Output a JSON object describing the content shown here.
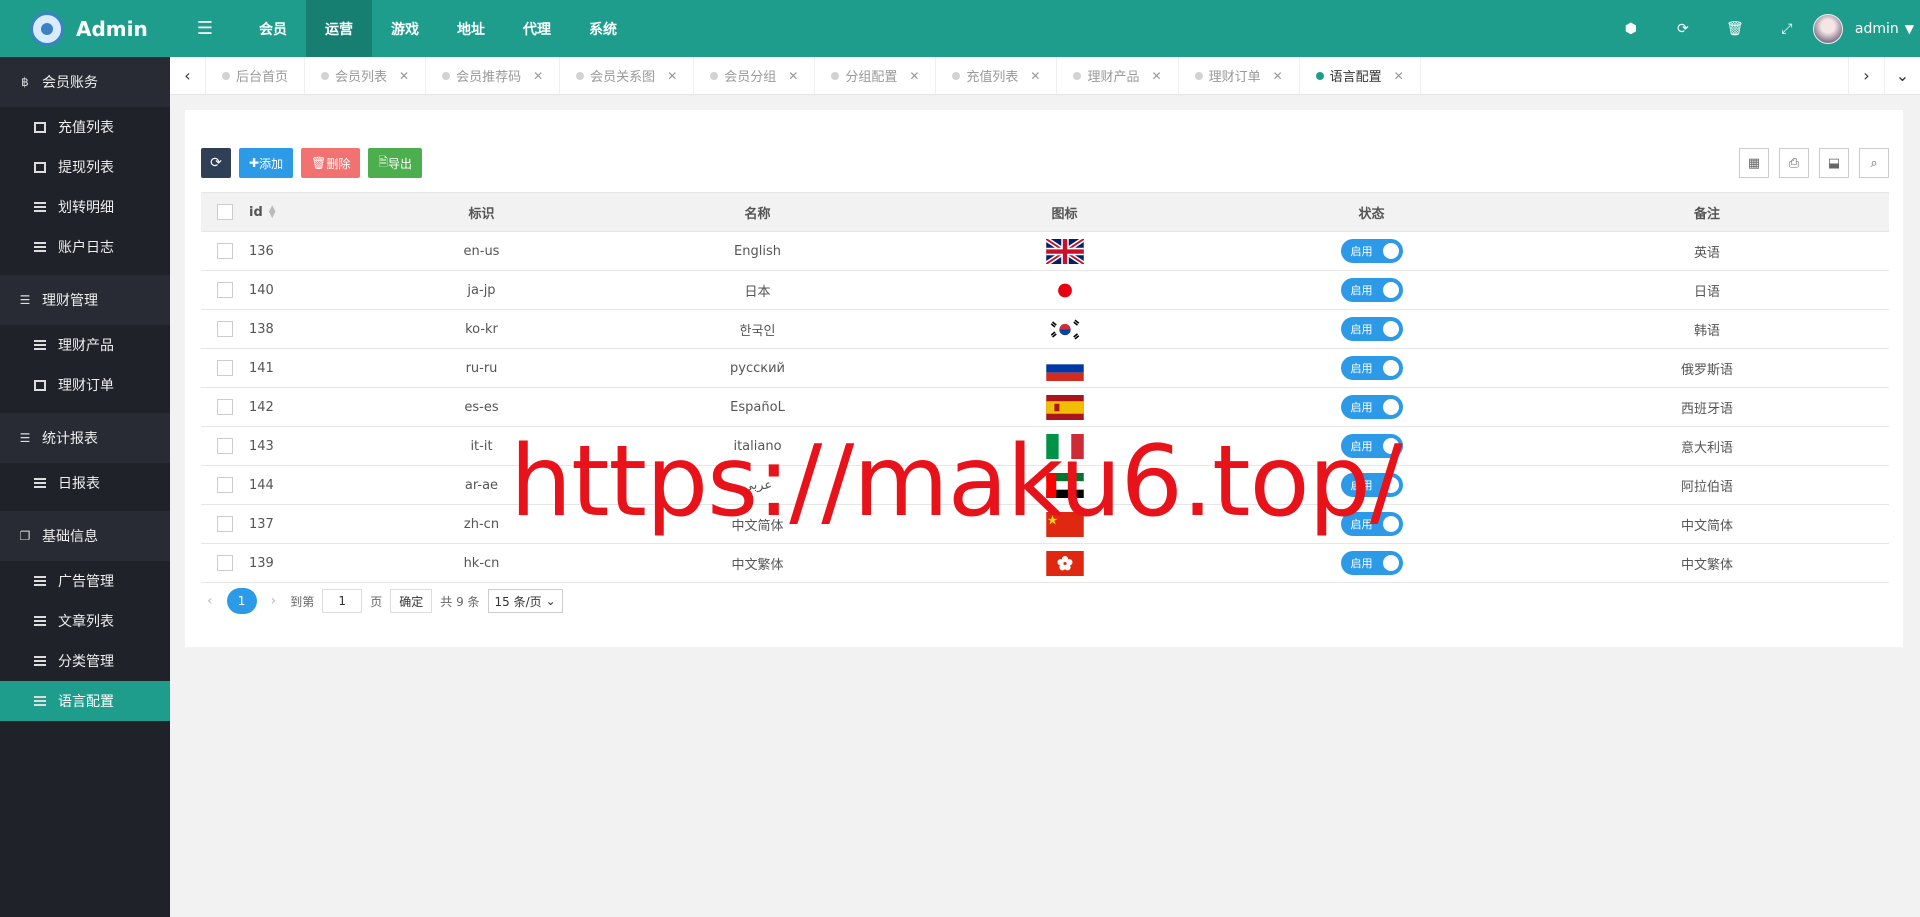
{
  "app": {
    "title": "Admin"
  },
  "sidebar": {
    "groups": [
      {
        "label": "会员账务",
        "items": [
          "充值列表",
          "提现列表",
          "划转明细",
          "账户日志"
        ]
      },
      {
        "label": "理财管理",
        "items": [
          "理财产品",
          "理财订单"
        ]
      },
      {
        "label": "统计报表",
        "items": [
          "日报表"
        ]
      },
      {
        "label": "基础信息",
        "items": [
          "广告管理",
          "文章列表",
          "分类管理",
          "语言配置"
        ]
      }
    ],
    "active_item": "语言配置"
  },
  "header": {
    "nav": [
      "会员",
      "运营",
      "游戏",
      "地址",
      "代理",
      "系统"
    ],
    "active_nav": "运营",
    "user": "admin"
  },
  "tabs": [
    "后台首页",
    "会员列表",
    "会员推荐码",
    "会员关系图",
    "会员分组",
    "分组配置",
    "充值列表",
    "理财产品",
    "理财订单",
    "语言配置"
  ],
  "active_tab": "语言配置",
  "toolbar": {
    "add_label": "添加",
    "delete_label": "删除",
    "export_label": "导出"
  },
  "table": {
    "columns": [
      "id",
      "标识",
      "名称",
      "图标",
      "状态",
      "备注"
    ],
    "status_label": "启用",
    "rows": [
      {
        "id": "136",
        "code": "en-us",
        "name": "English",
        "flag": "uk-flag",
        "remark": "英语"
      },
      {
        "id": "140",
        "code": "ja-jp",
        "name": "日本",
        "flag": "japan-flag",
        "remark": "日语"
      },
      {
        "id": "138",
        "code": "ko-kr",
        "name": "한국인",
        "flag": "korea-flag",
        "remark": "韩语"
      },
      {
        "id": "141",
        "code": "ru-ru",
        "name": "русский",
        "flag": "russia-flag",
        "remark": "俄罗斯语"
      },
      {
        "id": "142",
        "code": "es-es",
        "name": "EspañoL",
        "flag": "spain-flag",
        "remark": "西班牙语"
      },
      {
        "id": "143",
        "code": "it-it",
        "name": "italiano",
        "flag": "italy-flag",
        "remark": "意大利语"
      },
      {
        "id": "144",
        "code": "ar-ae",
        "name": "عربي",
        "flag": "uae-flag",
        "remark": "阿拉伯语"
      },
      {
        "id": "137",
        "code": "zh-cn",
        "name": "中文简体",
        "flag": "china-flag",
        "remark": "中文简体"
      },
      {
        "id": "139",
        "code": "hk-cn",
        "name": "中文繁体",
        "flag": "hongkong-flag",
        "remark": "中文繁体"
      }
    ]
  },
  "pagination": {
    "current": "1",
    "goto_prefix": "到第",
    "goto_value": "1",
    "goto_suffix": "页",
    "confirm": "确定",
    "total": "共 9 条",
    "page_size": "15 条/页"
  },
  "watermark": "https://maku6.top/",
  "colors": {
    "accent": "#1e9d8d",
    "primary": "#2d9ae8",
    "danger": "#f27272",
    "success": "#4cae4c",
    "sidebar": "#20222a",
    "watermark": "#e8131a"
  }
}
